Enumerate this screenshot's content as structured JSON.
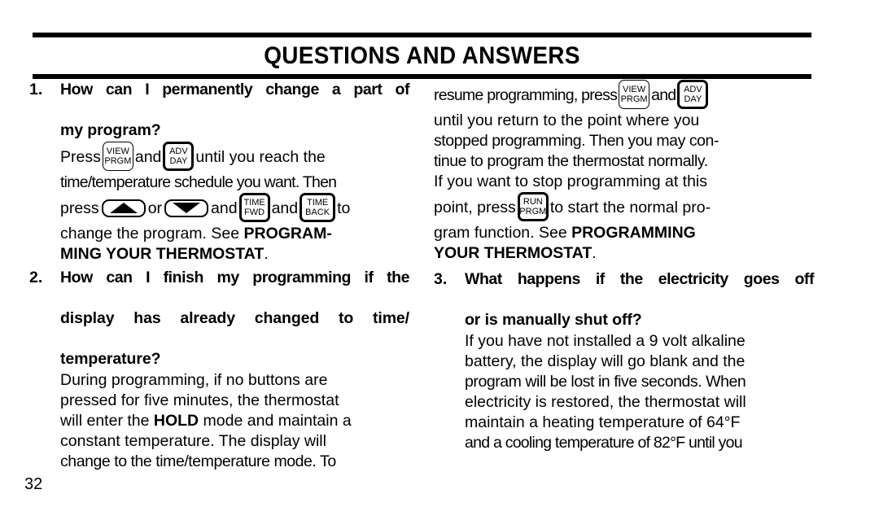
{
  "header": {
    "title": "QUESTIONS AND ANSWERS"
  },
  "page_number": "32",
  "keys": {
    "view_prgm": {
      "line1": "VIEW",
      "line2": "PRGM"
    },
    "adv_day": {
      "line1": "ADV",
      "line2": "DAY"
    },
    "time_fwd": {
      "line1": "TIME",
      "line2": "FWD"
    },
    "time_back": {
      "line1": "TIME",
      "line2": "BACK"
    },
    "run_prgm": {
      "line1": "RUN",
      "line2": "PRGM"
    },
    "up_arrow": "up-arrow-key",
    "down_arrow": "down-arrow-key"
  },
  "left_column": {
    "q1": {
      "number": "1.",
      "question_line1": "How can I permanently change a part of",
      "question_line2": "my program?",
      "answer": {
        "l1_a": "Press",
        "l1_b": "and",
        "l1_c": "until you reach the",
        "l2": "time/temperature schedule you want. Then",
        "l3_a": "press",
        "l3_b": "or",
        "l3_c": "and",
        "l3_d": "and",
        "l3_e": "to",
        "l4_a": "change the program. See ",
        "l4_bold": "PROGRAM-",
        "l5_bold": "MING YOUR THERMOSTAT",
        "l5_tail": "."
      }
    },
    "q2": {
      "number": "2.",
      "question_line1": "How can I finish my programming if the",
      "question_line2": "display has already changed to time/",
      "question_line3": "temperature?",
      "answer": {
        "l1": "During programming, if no buttons are",
        "l2": "pressed for five minutes, the thermostat",
        "l3_a": "will enter the ",
        "l3_bold": "HOLD",
        "l3_b": " mode and maintain a",
        "l4": "constant temperature. The display will",
        "l5": "change to the time/temperature mode. To"
      }
    }
  },
  "right_column": {
    "q1_cont": {
      "l1_a": "resume programming, press",
      "l1_b": "and",
      "l2": "until you return to the point where you",
      "l3": "stopped programming. Then you may con-",
      "l4": "tinue to program the thermostat normally.",
      "l5": "If you want to stop programming at this",
      "l6_a": "point, press",
      "l6_b": "to start the normal pro-",
      "l7_a": "gram function. See ",
      "l7_bold": "PROGRAMMING",
      "l8_bold": "YOUR THERMOSTAT",
      "l8_tail": "."
    },
    "q3": {
      "number": "3.",
      "question_line1": "What happens if the electricity goes off",
      "question_line2": "or is manually shut off?",
      "answer": {
        "l1": "If you have not installed a 9 volt alkaline",
        "l2": "battery, the display will go blank and the",
        "l3": "program will be lost in five seconds. When",
        "l4": "electricity is restored, the thermostat will",
        "l5": "maintain a heating temperature of 64°F",
        "l6": "and a cooling temperature of 82°F until you"
      }
    }
  }
}
